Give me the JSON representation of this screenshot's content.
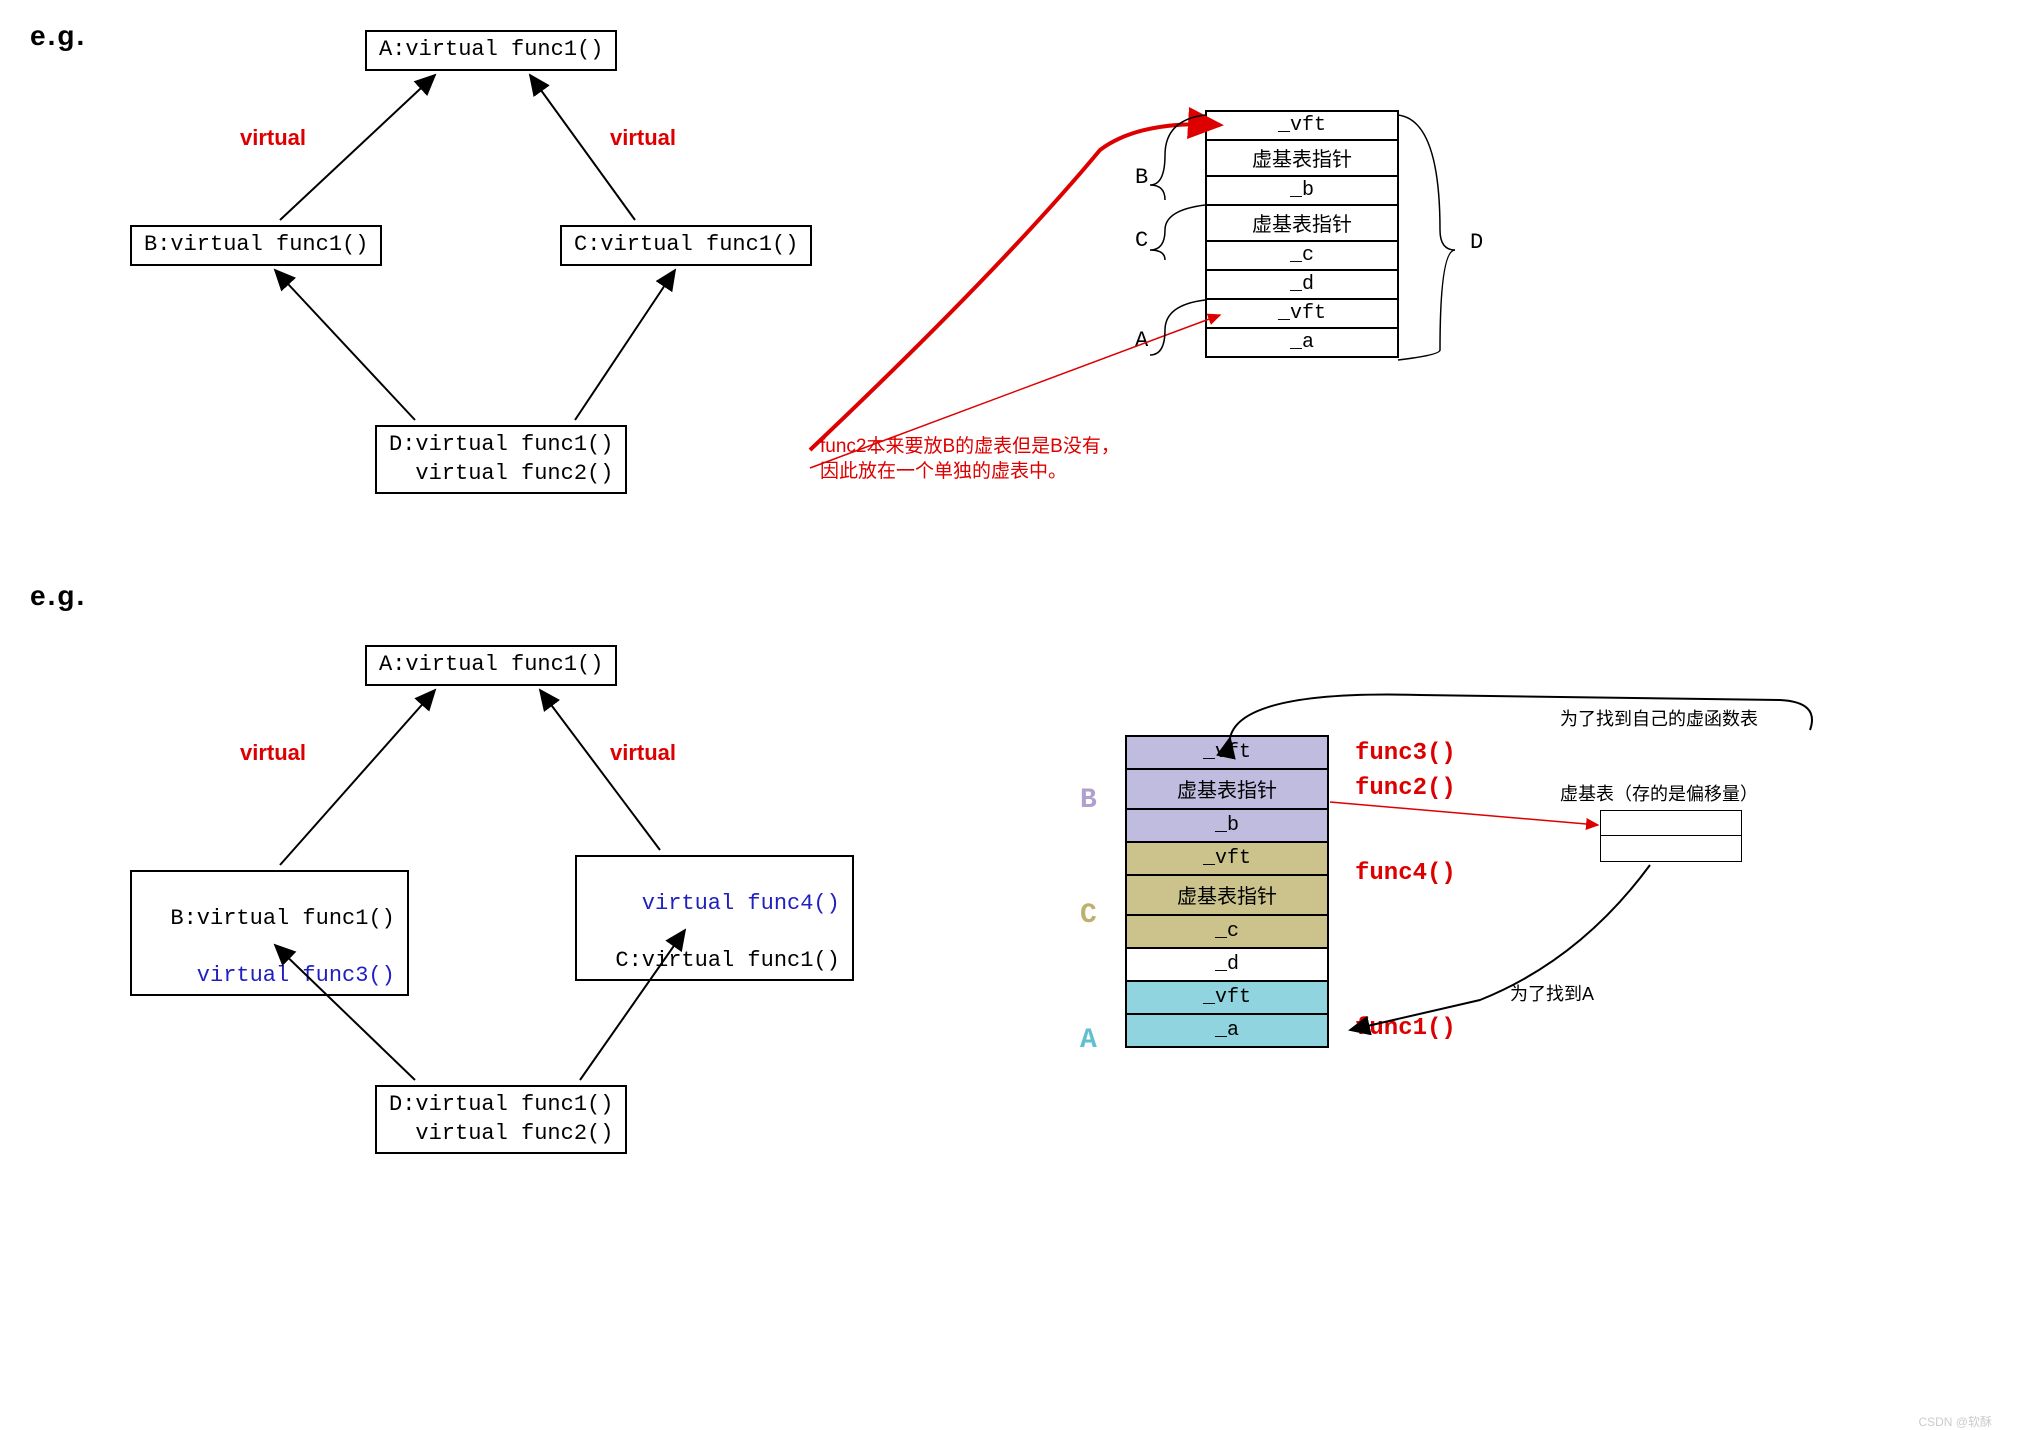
{
  "eg": "e.g.",
  "d1": {
    "A": "A:virtual func1()",
    "B": "B:virtual func1()",
    "C": "C:virtual func1()",
    "D": "D:virtual func1()\n virtual func2()",
    "virtual": "virtual",
    "mem": [
      "_vft",
      "虚基表指针",
      "_b",
      "虚基表指针",
      "_c",
      "_d",
      "_vft",
      "_a"
    ],
    "lblB": "B",
    "lblC": "C",
    "lblA": "A",
    "lblD": "D",
    "note": "func2本来要放B的虚表但是B没有，\n因此放在一个单独的虚表中。"
  },
  "d2": {
    "A": "A:virtual func1()",
    "B": "B:virtual func1()",
    "B2": "virtual func3()",
    "C": "C:virtual func1()",
    "C2": "virtual func4()",
    "D": "D:virtual func1()\n virtual func2()",
    "virtual": "virtual",
    "memB": [
      "_vft",
      "虚基表指针",
      "_b"
    ],
    "memC": [
      "_vft",
      "虚基表指针",
      "_c"
    ],
    "memD": "_d",
    "memA": [
      "_vft",
      "_a"
    ],
    "lblB": "B",
    "lblC": "C",
    "lblA": "A",
    "f3": "func3()",
    "f2": "func2()",
    "f4": "func4()",
    "f1": "func1()",
    "n1": "为了找到自己的虚函数表",
    "n2": "虚基表（存的是偏移量）",
    "n3": "为了找到A"
  },
  "watermark": "CSDN @软酥"
}
